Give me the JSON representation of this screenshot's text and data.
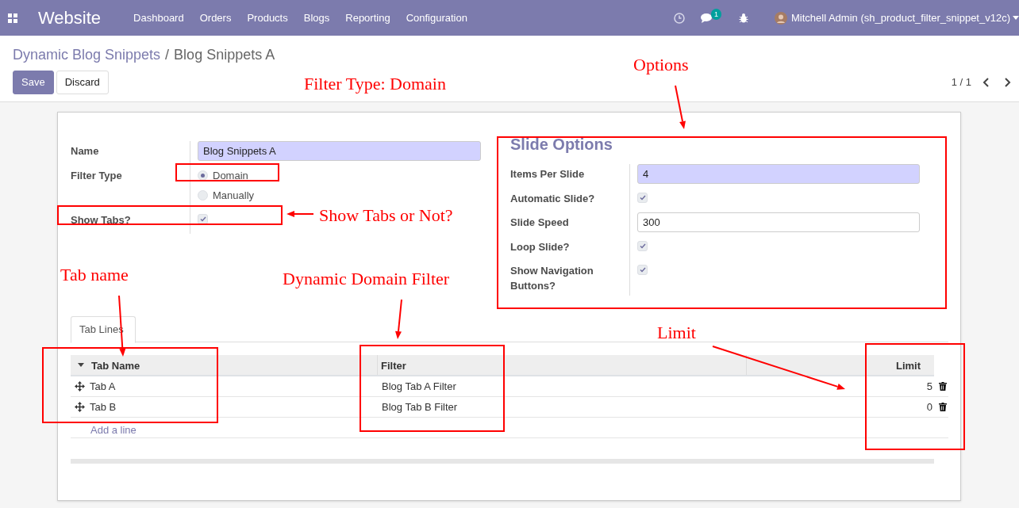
{
  "navbar": {
    "app_title": "Website",
    "menu": [
      "Dashboard",
      "Orders",
      "Products",
      "Blogs",
      "Reporting",
      "Configuration"
    ],
    "message_count": "1",
    "user": "Mitchell Admin (sh_product_filter_snippet_v12c)"
  },
  "breadcrumb": {
    "parent": "Dynamic Blog Snippets",
    "separator": "/",
    "current": "Blog Snippets A"
  },
  "buttons": [
    {
      "label": "Save",
      "kind": "primary"
    },
    {
      "label": "Discard",
      "kind": "secondary"
    }
  ],
  "pager": "1 / 1",
  "main_fields": [
    {
      "kind": "text",
      "label": "Name",
      "value": "Blog Snippets A",
      "required": true
    },
    {
      "kind": "radio",
      "label": "Filter Type",
      "options": [
        {
          "label": "Domain",
          "selected": true
        },
        {
          "label": "Manually",
          "selected": false
        }
      ]
    },
    {
      "kind": "checkbox",
      "label": "Show Tabs?",
      "checked": true
    }
  ],
  "slide_options": {
    "title": "Slide Options",
    "fields": [
      {
        "kind": "text",
        "label": "Items Per Slide",
        "value": "4",
        "required": true
      },
      {
        "kind": "checkbox",
        "label": "Automatic Slide?",
        "checked": true
      },
      {
        "kind": "text",
        "label": "Slide Speed",
        "value": "300",
        "required": false
      },
      {
        "kind": "checkbox",
        "label": "Loop Slide?",
        "checked": true
      },
      {
        "kind": "checkbox",
        "label": "Show Navigation Buttons?",
        "checked": true
      }
    ]
  },
  "tabs": [
    {
      "label": "Tab Lines",
      "selected": true
    }
  ],
  "table": {
    "columns": [
      "Tab Name",
      "Filter",
      "Limit"
    ],
    "rows": [
      {
        "tab_name": "Tab A",
        "filter": "Blog Tab A Filter",
        "limit": "5"
      },
      {
        "tab_name": "Tab B",
        "filter": "Blog Tab B Filter",
        "limit": "0"
      }
    ],
    "add_line": "Add a line"
  },
  "annotations": [
    {
      "text": "Filter Type: Domain"
    },
    {
      "text": "Options"
    },
    {
      "text": "Show Tabs or Not?"
    },
    {
      "text": "Tab name"
    },
    {
      "text": "Dynamic Domain Filter"
    },
    {
      "text": "Limit"
    }
  ]
}
